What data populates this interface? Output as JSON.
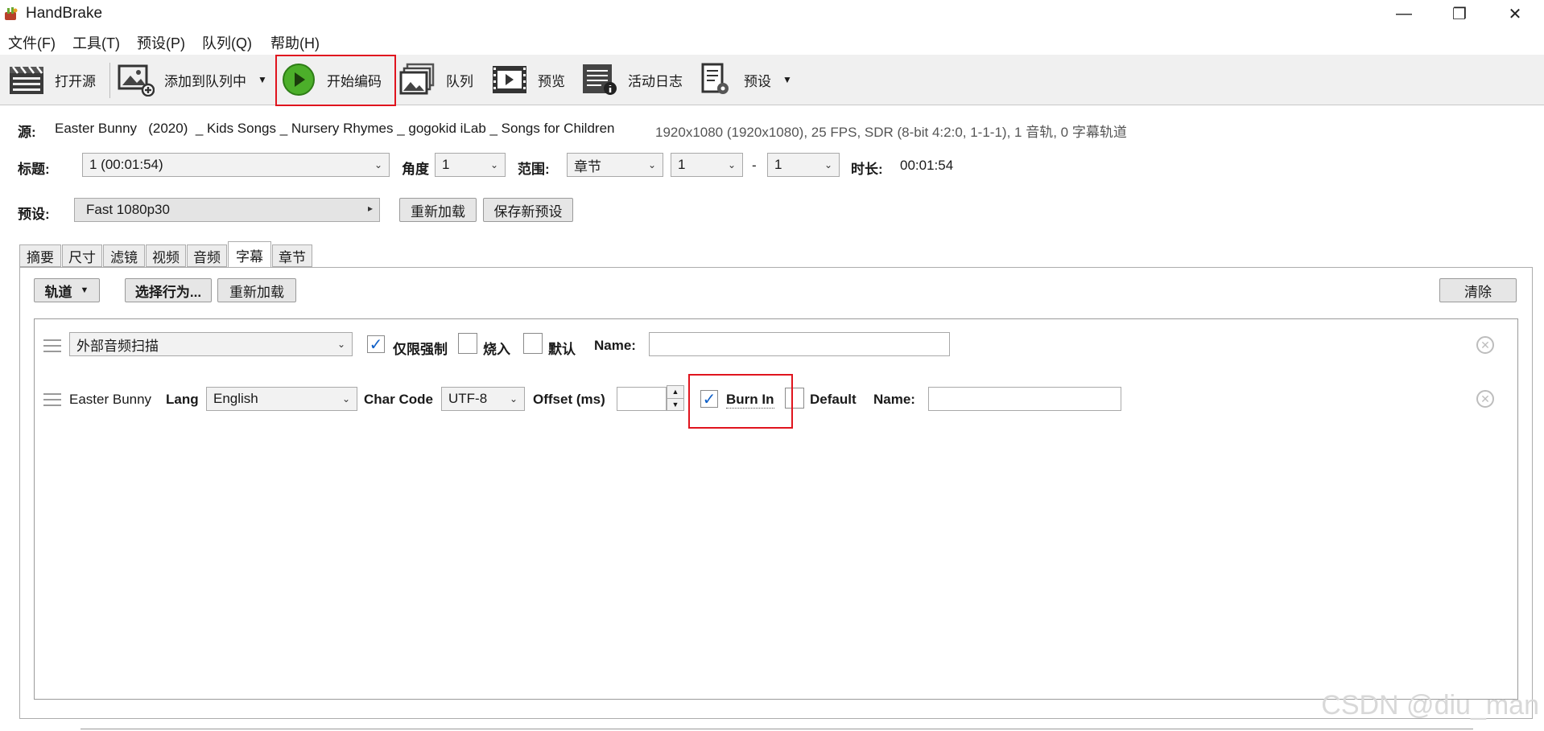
{
  "window": {
    "title": "HandBrake",
    "controls": [
      "minimize-icon",
      "restore-icon",
      "close-icon"
    ]
  },
  "menu": [
    "文件(F)",
    "工具(T)",
    "预设(P)",
    "队列(Q)",
    "帮助(H)"
  ],
  "toolbar": {
    "open_source": "打开源",
    "add_to_queue": "添加到队列中",
    "start_encode": "开始编码",
    "queue": "队列",
    "preview": "预览",
    "activity_log": "活动日志",
    "presets": "预设"
  },
  "source": {
    "label": "源:",
    "name": "Easter Bunny   (2020)  _ Kids Songs _ Nursery Rhymes _ gogokid iLab _ Songs for Children",
    "info": "1920x1080 (1920x1080), 25 FPS, SDR (8-bit 4:2:0, 1-1-1), 1 音轨, 0 字幕轨道"
  },
  "title_row": {
    "title_label": "标题:",
    "title_value": "1  (00:01:54)",
    "angle_label": "角度",
    "angle_value": "1",
    "range_label": "范围:",
    "range_type": "章节",
    "range_start": "1",
    "range_sep": "-",
    "range_end": "1",
    "duration_label": "时长:",
    "duration_value": "00:01:54"
  },
  "preset_row": {
    "label": "预设:",
    "value": "Fast 1080p30",
    "reload": "重新加载",
    "save_new": "保存新预设"
  },
  "tabs": [
    "摘要",
    "尺寸",
    "滤镜",
    "视频",
    "音频",
    "字幕",
    "章节"
  ],
  "active_tab": "字幕",
  "subtitles": {
    "tracks_btn": "轨道",
    "select_behavior": "选择行为...",
    "reload": "重新加载",
    "clear": "清除",
    "row1": {
      "track": "外部音频扫描",
      "forced_only": "仅限强制",
      "forced_only_checked": true,
      "burn_in": "烧入",
      "burn_in_checked": false,
      "default": "默认",
      "default_checked": false,
      "name_label": "Name:",
      "name_value": ""
    },
    "row2": {
      "track": "Easter Bunny",
      "lang_label": "Lang",
      "lang_value": "English",
      "charcode_label": "Char Code",
      "charcode_value": "UTF-8",
      "offset_label": "Offset (ms)",
      "offset_value": "",
      "burn_in": "Burn In",
      "burn_in_checked": true,
      "default": "Default",
      "default_checked": false,
      "name_label": "Name:",
      "name_value": ""
    }
  },
  "watermark": "CSDN @diu_man",
  "colors": {
    "highlight": "#e0141e",
    "check": "#1060c8",
    "play_green": "#4caf2a"
  }
}
